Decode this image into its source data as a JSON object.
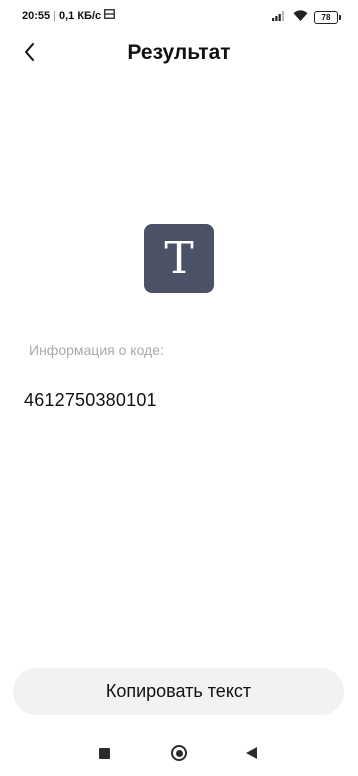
{
  "status_bar": {
    "time": "20:55",
    "separator": "|",
    "network_speed": "0,1 КБ/с",
    "battery": "78"
  },
  "header": {
    "title": "Результат"
  },
  "result": {
    "type_icon_letter": "T",
    "info_label": "Информация о коде:",
    "code_value": "4612750380101"
  },
  "actions": {
    "copy_label": "Копировать текст"
  },
  "colors": {
    "icon_background": "#4c5266",
    "button_background": "#f2f2f2",
    "label_gray": "#a9a9a9"
  },
  "icons": {
    "back": "chevron-left-icon",
    "signal": "cellular-signal-icon",
    "wifi": "wifi-icon",
    "battery": "battery-icon",
    "nav_recents": "square-icon",
    "nav_home": "circle-icon",
    "nav_back": "triangle-back-icon"
  }
}
